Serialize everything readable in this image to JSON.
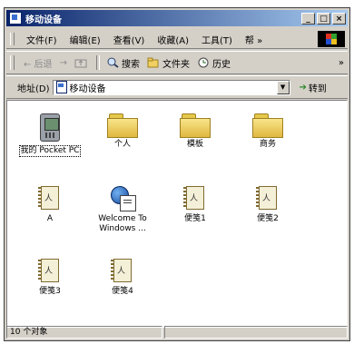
{
  "window": {
    "title": "移动设备",
    "controls": {
      "minimize": "_",
      "maximize": "□",
      "close": "×"
    }
  },
  "menu": [
    "文件(F)",
    "编辑(E)",
    "查看(V)",
    "收藏(A)",
    "工具(T)",
    "帮 »"
  ],
  "toolbar": {
    "back": "← 后退",
    "forward": "→",
    "up": "",
    "search": "搜索",
    "folders": "文件夹",
    "history": "历史",
    "overflow": "»"
  },
  "address": {
    "label": "地址(D)",
    "value": "移动设备",
    "go": "转到"
  },
  "items": [
    {
      "label": "我的 Pocket PC",
      "icon": "pocket-pc-icon"
    },
    {
      "label": "个人",
      "icon": "folder-icon"
    },
    {
      "label": "模板",
      "icon": "folder-icon"
    },
    {
      "label": "商务",
      "icon": "folder-icon"
    },
    {
      "label": "A",
      "icon": "note-icon"
    },
    {
      "label": "Welcome To Windows ...",
      "icon": "welcome-icon"
    },
    {
      "label": "便笺1",
      "icon": "note-icon"
    },
    {
      "label": "便笺2",
      "icon": "note-icon"
    },
    {
      "label": "便笺3",
      "icon": "note-icon"
    },
    {
      "label": "便笺4",
      "icon": "note-icon"
    }
  ],
  "status": {
    "count": "10 个对象"
  }
}
